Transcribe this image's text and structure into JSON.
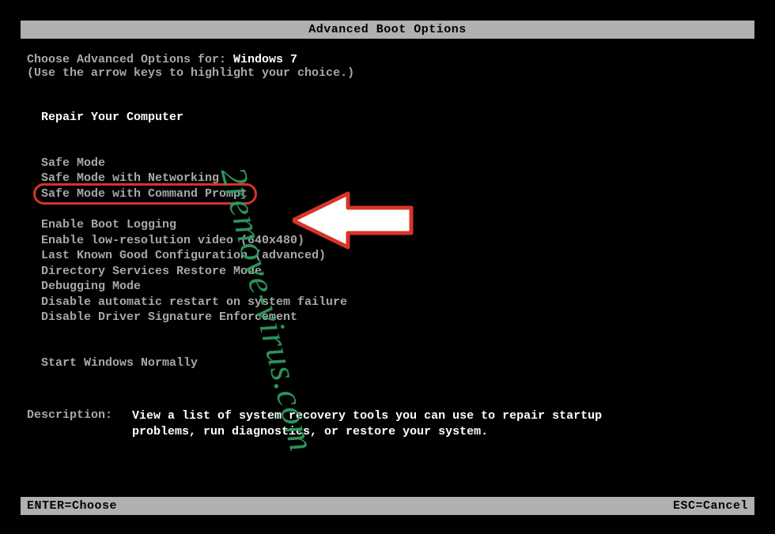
{
  "title": "Advanced Boot Options",
  "intro": {
    "prefix": "Choose Advanced Options for: ",
    "os": "Windows 7",
    "hint": "(Use the arrow keys to highlight your choice.)"
  },
  "menu": {
    "repair": "Repair Your Computer",
    "safe_mode": "Safe Mode",
    "safe_mode_net": "Safe Mode with Networking",
    "safe_mode_cmd": "Safe Mode with Command Prompt",
    "boot_log": "Enable Boot Logging",
    "low_res": "Enable low-resolution video (640x480)",
    "last_known": "Last Known Good Configuration (advanced)",
    "ds_restore": "Directory Services Restore Mode",
    "debug": "Debugging Mode",
    "no_auto_restart": "Disable automatic restart on system failure",
    "no_driver_sig": "Disable Driver Signature Enforcement",
    "start_normal": "Start Windows Normally"
  },
  "description": {
    "label": "Description:",
    "text": "View a list of system recovery tools you can use to repair startup problems, run diagnostics, or restore your system."
  },
  "footer": {
    "left": "ENTER=Choose",
    "right": "ESC=Cancel"
  },
  "watermark": "2remove-virus.com",
  "annotation": {
    "highlight_color": "#d63528",
    "arrow_fill": "#ffffff"
  }
}
